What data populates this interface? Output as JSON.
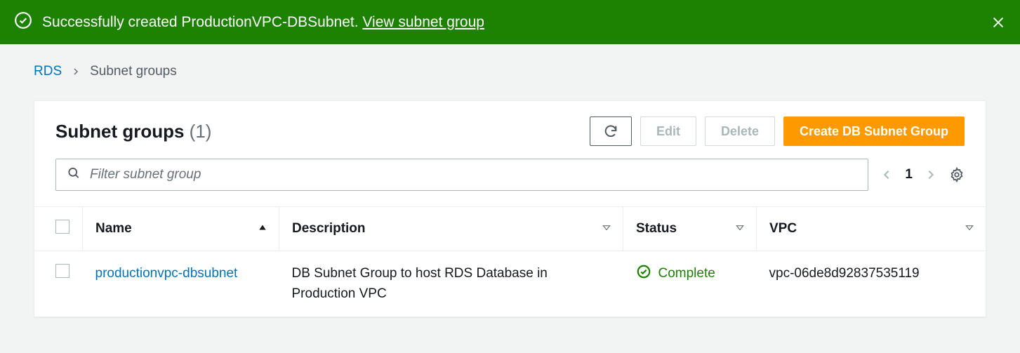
{
  "flash": {
    "message_prefix": "Successfully created ProductionVPC-DBSubnet. ",
    "link_text": "View subnet group"
  },
  "breadcrumb": {
    "root": "RDS",
    "current": "Subnet groups"
  },
  "panel": {
    "title": "Subnet groups",
    "count": "(1)",
    "buttons": {
      "edit": "Edit",
      "delete": "Delete",
      "create": "Create DB Subnet Group"
    },
    "search_placeholder": "Filter subnet group",
    "page": "1"
  },
  "table": {
    "headers": {
      "name": "Name",
      "description": "Description",
      "status": "Status",
      "vpc": "VPC"
    },
    "rows": [
      {
        "name": "productionvpc-dbsubnet",
        "description": "DB Subnet Group to host RDS Database in Production VPC",
        "status": "Complete",
        "vpc": "vpc-06de8d92837535119"
      }
    ]
  }
}
